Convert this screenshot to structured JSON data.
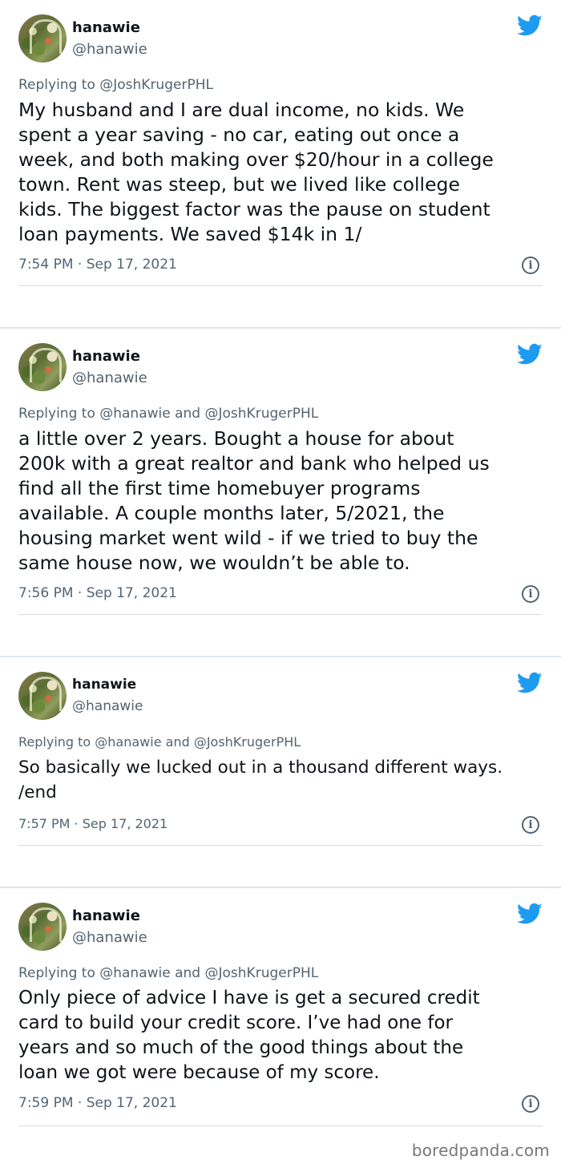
{
  "tweets": [
    {
      "name": "hanawie",
      "handle": "@hanawie",
      "replying": "Replying to @JoshKrugerPHL",
      "text": "My husband and I are dual income, no kids. We\nspent a year saving - no car, eating out once a\nweek, and both making over $20/hour in a college\ntown. Rent was steep, but we lived like college\nkids. The biggest factor was the pause on student\nloan payments. We saved $14k in 1/",
      "time": "7:54 PM · Sep 17, 2021"
    },
    {
      "name": "hanawie",
      "handle": "@hanawie",
      "replying": "Replying to @hanawie and @JoshKrugerPHL",
      "text": "a little over 2 years. Bought a house for about\n200k with a great realtor and bank who helped us\nfind all the first time homebuyer programs\navailable. A couple months later, 5/2021, the\nhousing market went wild - if we tried to buy the\nsame house now, we wouldn’t be able to.",
      "time": "7:56 PM · Sep 17, 2021"
    },
    {
      "name": "hanawie",
      "handle": "@hanawie",
      "replying": "Replying to @hanawie and @JoshKrugerPHL",
      "text": "So basically we lucked out in a thousand different ways.\n/end",
      "time": "7:57 PM · Sep 17, 2021"
    },
    {
      "name": "hanawie",
      "handle": "@hanawie",
      "replying": "Replying to @hanawie and @JoshKrugerPHL",
      "text": "Only piece of advice I have is get a secured credit\ncard to build your credit score. I’ve had one for\nyears and so much of the good things about the\nloan we got were because of my score.",
      "time": "7:59 PM · Sep 17, 2021"
    }
  ],
  "icons": {
    "bird": "twitter-bird-icon",
    "info": "info-icon",
    "info_glyph": "i"
  },
  "colors": {
    "twitter_blue": "#1d9bf0",
    "secondary_text": "#536471"
  },
  "watermark": "boredpanda.com"
}
